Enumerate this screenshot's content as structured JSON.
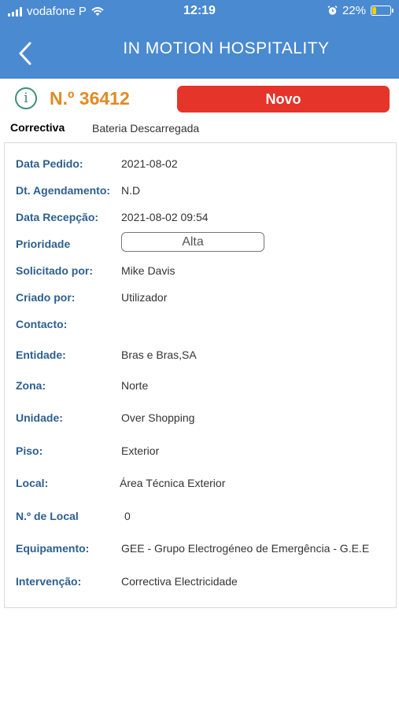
{
  "status_bar": {
    "carrier": "vodafone P",
    "time": "12:19",
    "battery": "22%",
    "battery_level": 0.22
  },
  "nav": {
    "back_icon": "chevron-left-icon",
    "title": "IN MOTION HOSPITALITY"
  },
  "order": {
    "info_icon": "info-icon",
    "number": "N.º 36412",
    "status": "Novo",
    "status_color": "#e5342a",
    "type": "Correctiva",
    "description": "Bateria Descarregada"
  },
  "details": [
    {
      "label": "Data Pedido:",
      "value": "2021-08-02"
    },
    {
      "label": "Dt. Agendamento:",
      "value": "N.D"
    },
    {
      "label": "Data Recepção:",
      "value": "2021-08-02 09:54"
    },
    {
      "label": "Prioridade",
      "value": "Alta"
    },
    {
      "label": "Solicitado por:",
      "value": "Mike Davis"
    },
    {
      "label": "Criado por:",
      "value": "Utilizador"
    },
    {
      "label": "Contacto:",
      "value": ""
    },
    {
      "label": "Entidade:",
      "value": "Bras e Bras,SA"
    },
    {
      "label": "Zona:",
      "value": "Norte"
    },
    {
      "label": "Unidade:",
      "value": "Over Shopping"
    },
    {
      "label": "Piso:",
      "value": "Exterior"
    },
    {
      "label": "Local:",
      "value": "Área Técnica Exterior"
    },
    {
      "label": "N.º de Local",
      "value": "0"
    },
    {
      "label": "Equipamento:",
      "value": "GEE - Grupo Electrogéneo de Emergência - G.E.E"
    },
    {
      "label": "Intervenção:",
      "value": "Correctiva Electricidade"
    }
  ]
}
